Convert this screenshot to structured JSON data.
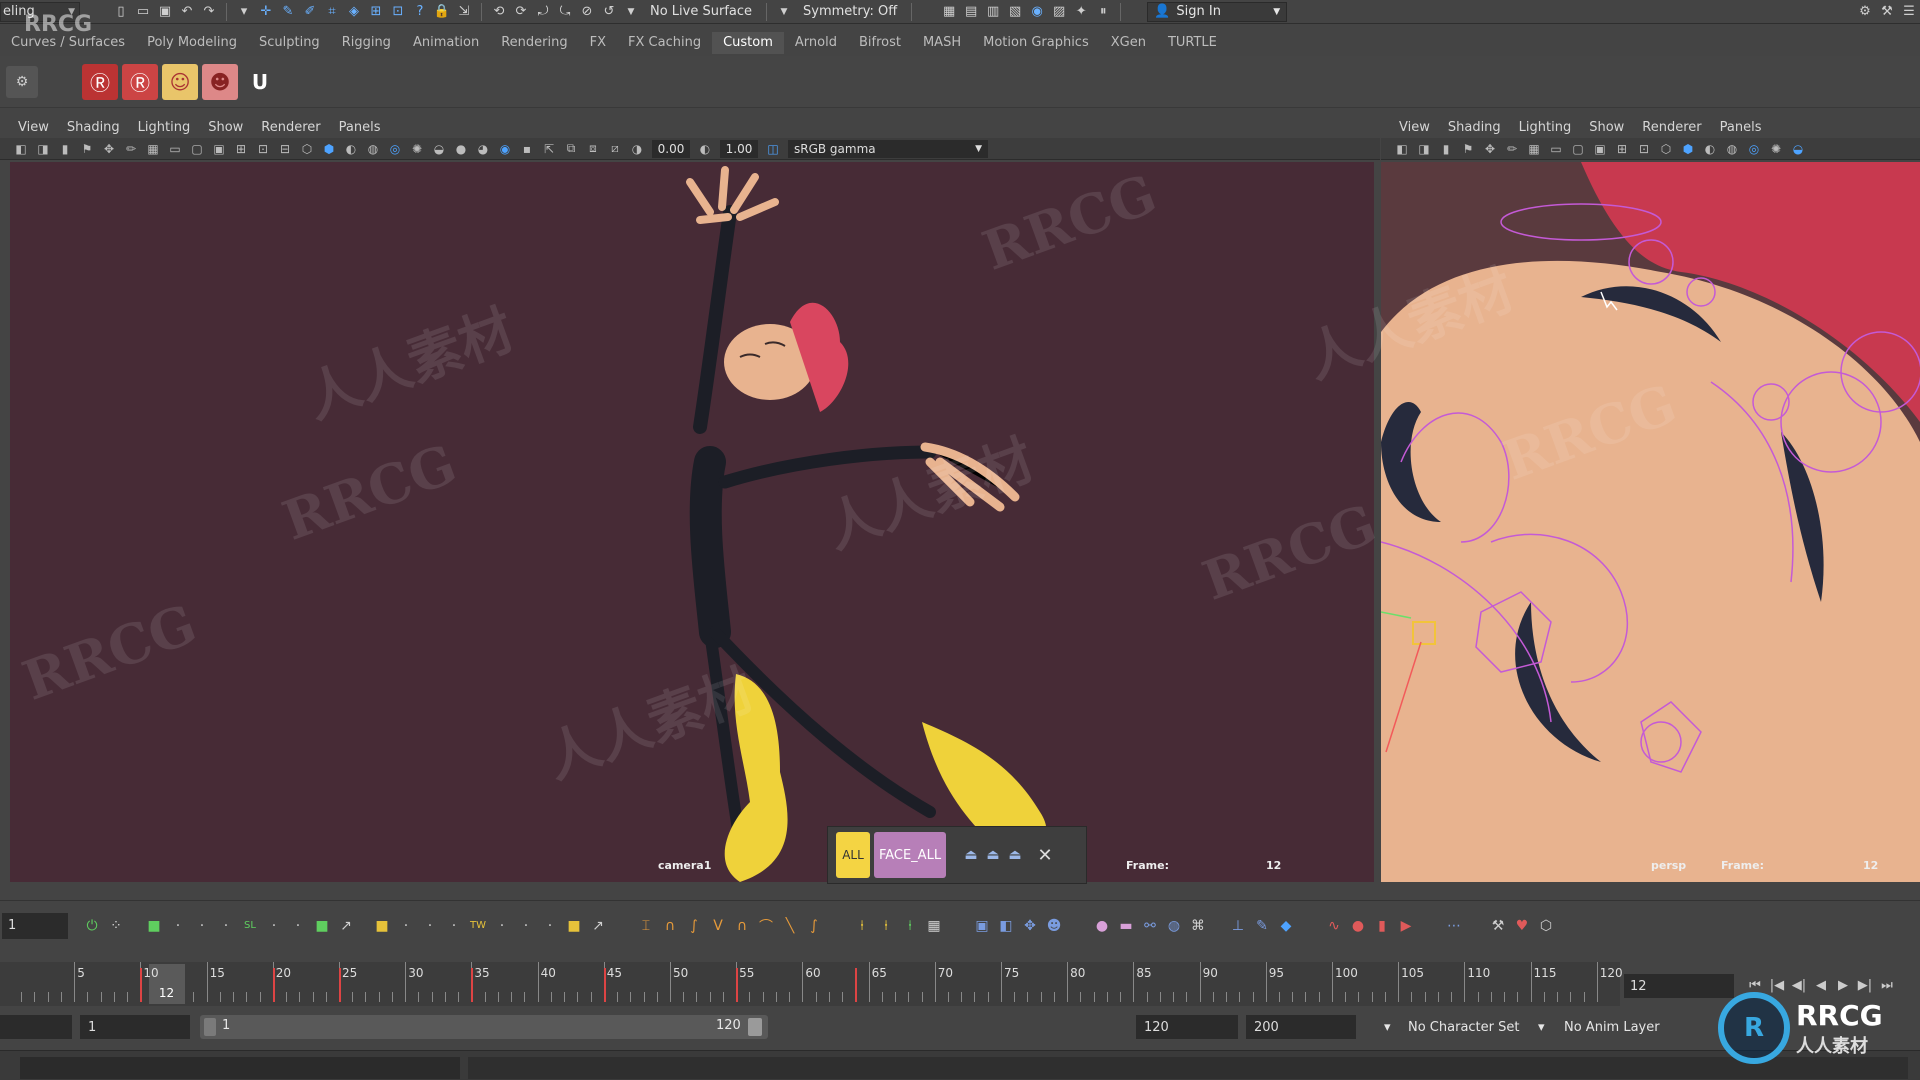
{
  "status": {
    "mode": "eling",
    "live_surface": "No Live Surface",
    "symmetry": "Symmetry: Off",
    "sign_in": "Sign In"
  },
  "shelf_tabs": [
    "Curves / Surfaces",
    "Poly Modeling",
    "Sculpting",
    "Rigging",
    "Animation",
    "Rendering",
    "FX",
    "FX Caching",
    "Custom",
    "Arnold",
    "Bifrost",
    "MASH",
    "Motion Graphics",
    "XGen",
    "TURTLE"
  ],
  "active_shelf": "Custom",
  "panel_menu": [
    "View",
    "Shading",
    "Lighting",
    "Show",
    "Renderer",
    "Panels"
  ],
  "left_panel": {
    "exposure": "0.00",
    "gamma": "1.00",
    "color_space": "sRGB gamma",
    "camera": "camera1",
    "frame_label": "Frame:",
    "frame_value": "12"
  },
  "right_panel": {
    "camera": "persp",
    "frame_label": "Frame:",
    "frame_value": "12"
  },
  "selector": {
    "all": "ALL",
    "face_all": "FACE_ALL"
  },
  "anim": {
    "current_frame": "1",
    "timeline_ticks": [
      "5",
      "10",
      "15",
      "20",
      "25",
      "30",
      "35",
      "40",
      "45",
      "50",
      "55",
      "60",
      "65",
      "70",
      "75",
      "80",
      "85",
      "90",
      "95",
      "100",
      "105",
      "110",
      "115",
      "120"
    ],
    "current_time": "12",
    "end_field": "12",
    "range_start": "1",
    "range_inner_start": "1",
    "range_inner_end": "120",
    "anim_end": "120",
    "playback_end": "200",
    "character_set": "No Character Set",
    "anim_layer": "No Anim Layer"
  },
  "watermark": {
    "text1": "RRCG",
    "text2": "人人素材"
  },
  "logo": {
    "badge": "R",
    "brand": "RRCG",
    "sub": "人人素材"
  },
  "colors": {
    "viewport_left": "#472b36",
    "face_skin": "#e8b38f",
    "hair": "#d9465f",
    "control_curves": "#c45ad6",
    "all_button": "#f4d443",
    "face_button": "#b77fb8"
  }
}
